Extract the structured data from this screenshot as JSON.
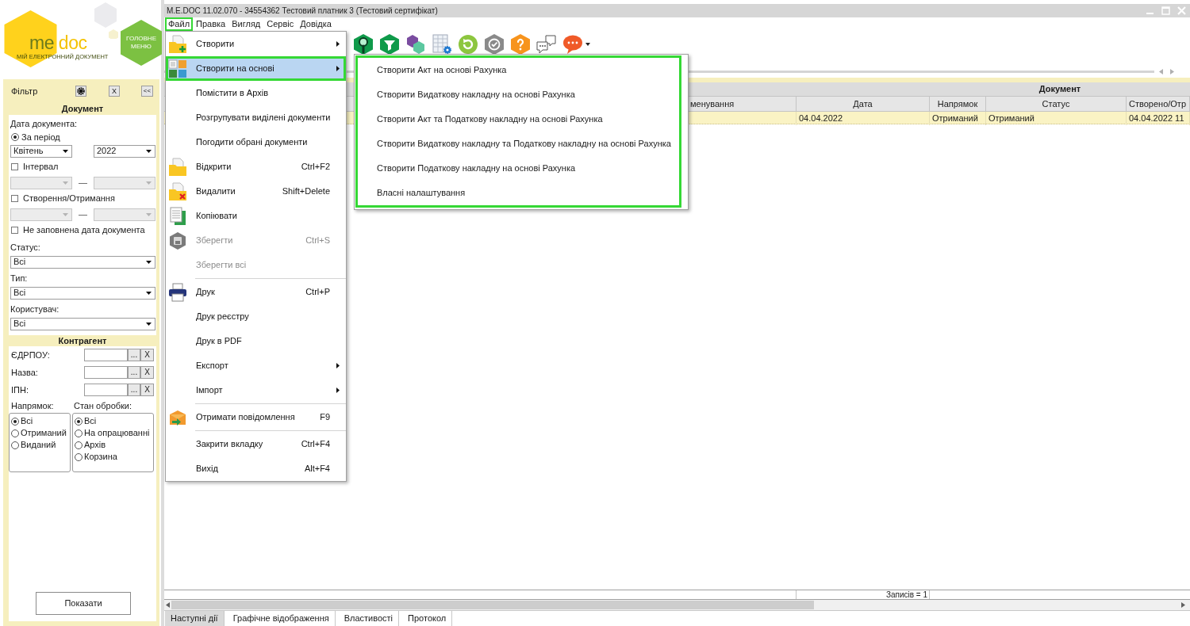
{
  "logo": {
    "wordmark": [
      "me",
      "doc"
    ],
    "tagline": "МІЙ ЕЛЕКТРОННИЙ ДОКУМЕНТ"
  },
  "main_menu_button": "ГОЛОВНЕ МЕНЮ",
  "filter": {
    "title": "Фільтр",
    "header_buttons": [
      "X",
      "<<"
    ],
    "document": {
      "title": "Документ",
      "rows": [
        {
          "kind": "label",
          "text": "Дата документа:"
        },
        {
          "kind": "radio",
          "label": "За період",
          "selected": true
        },
        {
          "kind": "select_pair",
          "disabled": false,
          "values": [
            "Квітень",
            "2022"
          ]
        },
        {
          "kind": "checkbox",
          "label": "Інтервал",
          "checked": false
        },
        {
          "kind": "select_pair",
          "disabled": true,
          "dash": "—"
        },
        {
          "kind": "checkbox",
          "label": "Створення/Отримання",
          "checked": false
        },
        {
          "kind": "select_pair",
          "disabled": true,
          "dash": "—"
        },
        {
          "kind": "checkbox",
          "label": "Не заповнена дата документа",
          "checked": false
        },
        {
          "kind": "label",
          "text": "Статус:"
        },
        {
          "kind": "select",
          "value": "Всі",
          "disabled": false
        },
        {
          "kind": "label",
          "text": "Тип:"
        },
        {
          "kind": "select",
          "value": "Всі",
          "disabled": false
        },
        {
          "kind": "label",
          "text": "Користувач:"
        },
        {
          "kind": "select",
          "value": "Всі",
          "disabled": false
        }
      ]
    },
    "counterparty": {
      "title": "Контрагент",
      "fields": [
        {
          "label": "ЄДРПОУ:",
          "buttons": [
            "...",
            "X"
          ]
        },
        {
          "label": "Назва:",
          "buttons": [
            "...",
            "X"
          ]
        },
        {
          "label": "ІПН:",
          "buttons": [
            "...",
            "X"
          ]
        }
      ],
      "groups": [
        {
          "title": "Напрямок:",
          "options": [
            {
              "label": "Всі",
              "selected": true
            },
            {
              "label": "Отриманий",
              "selected": false
            },
            {
              "label": "Виданий",
              "selected": false
            }
          ]
        },
        {
          "title": "Стан обробки:",
          "options": [
            {
              "label": "Всі",
              "selected": true
            },
            {
              "label": "На опрацюванні",
              "selected": false
            },
            {
              "label": "Архів",
              "selected": false
            },
            {
              "label": "Корзина",
              "selected": false
            }
          ]
        }
      ]
    },
    "show_button": "Показати"
  },
  "window": {
    "title": "M.E.DOC 11.02.070 - 34554362 Тестовий платник 3 (Тестовий сертифікат)"
  },
  "menubar": [
    {
      "label": "Файл",
      "outlined": true
    },
    {
      "label": "Правка",
      "outlined": false
    },
    {
      "label": "Вигляд",
      "outlined": false
    },
    {
      "label": "Сервіс",
      "outlined": false
    },
    {
      "label": "Довідка",
      "outlined": false
    }
  ],
  "file_menu": {
    "sections": [
      {
        "items": [
          {
            "label": "Створити",
            "submenu": true,
            "disabled": false,
            "selected": false,
            "outlined": false
          },
          {
            "label": "Створити на основі",
            "submenu": true,
            "disabled": false,
            "selected": true,
            "outlined": true
          },
          {
            "label": "Помістити в Архів",
            "submenu": false,
            "disabled": false,
            "selected": false,
            "outlined": false
          },
          {
            "label": "Розгрупувати виділені документи",
            "submenu": false,
            "disabled": false,
            "selected": false,
            "outlined": false
          },
          {
            "label": "Погодити обрані документи",
            "submenu": false,
            "disabled": false,
            "selected": false,
            "outlined": false
          },
          {
            "label": "Відкрити",
            "shortcut": "Ctrl+F2",
            "submenu": false,
            "disabled": false,
            "selected": false,
            "outlined": false
          },
          {
            "label": "Видалити",
            "shortcut": "Shift+Delete",
            "submenu": false,
            "disabled": false,
            "selected": false,
            "outlined": false
          },
          {
            "label": "Копіювати",
            "submenu": false,
            "disabled": false,
            "selected": false,
            "outlined": false
          },
          {
            "label": "Зберегти",
            "shortcut": "Ctrl+S",
            "submenu": false,
            "disabled": true,
            "selected": false,
            "outlined": false
          },
          {
            "label": "Зберегти всі",
            "submenu": false,
            "disabled": true,
            "selected": false,
            "outlined": false
          }
        ]
      },
      {
        "items": [
          {
            "label": "Друк",
            "shortcut": "Ctrl+P",
            "submenu": false,
            "disabled": false,
            "selected": false,
            "outlined": false
          },
          {
            "label": "Друк реєстру",
            "submenu": false,
            "disabled": false,
            "selected": false,
            "outlined": false
          },
          {
            "label": "Друк в PDF",
            "submenu": false,
            "disabled": false,
            "selected": false,
            "outlined": false
          },
          {
            "label": "Експорт",
            "submenu": true,
            "disabled": false,
            "selected": false,
            "outlined": false
          },
          {
            "label": "Імпорт",
            "submenu": true,
            "disabled": false,
            "selected": false,
            "outlined": false
          }
        ]
      },
      {
        "items": [
          {
            "label": "Отримати повідомлення",
            "shortcut": "F9",
            "submenu": false,
            "disabled": false,
            "selected": false,
            "outlined": false
          }
        ]
      },
      {
        "items": [
          {
            "label": "Закрити вкладку",
            "shortcut": "Ctrl+F4",
            "submenu": false,
            "disabled": false,
            "selected": false,
            "outlined": false
          },
          {
            "label": "Вихід",
            "shortcut": "Alt+F4",
            "submenu": false,
            "disabled": false,
            "selected": false,
            "outlined": false
          }
        ]
      }
    ]
  },
  "submenu": {
    "outlined": true,
    "items": [
      {
        "label": "Створити Акт на основі Рахунка",
        "selected": false
      },
      {
        "label": "Створити Видаткову накладну на основі Рахунка",
        "selected": false
      },
      {
        "label": "Створити Акт та Податкову накладну на основі Рахунка",
        "selected": false
      },
      {
        "label": "Створити Видаткову накладну та Податкову накладну на основі Рахунка",
        "selected": false
      },
      {
        "label": "Створити Податкову накладну на основі Рахунка",
        "selected": false
      },
      {
        "label": "Власні налаштування",
        "selected": false
      }
    ]
  },
  "table": {
    "group_header": "Документ",
    "partial_column": "менування",
    "columns": [
      "Дата",
      "Напрямок",
      "Статус",
      "Створено/Отр"
    ],
    "rows": [
      {
        "selected": true,
        "cells": [
          "04.04.2022",
          "Отриманий",
          "Отриманий",
          "04.04.2022 11"
        ]
      }
    ],
    "footer": "Записів = 1"
  },
  "tabs": [
    {
      "label": "Наступні дії",
      "selected": true
    },
    {
      "label": "Графічне відображення",
      "selected": false
    },
    {
      "label": "Властивості",
      "selected": false
    },
    {
      "label": "Протокол",
      "selected": false
    }
  ]
}
